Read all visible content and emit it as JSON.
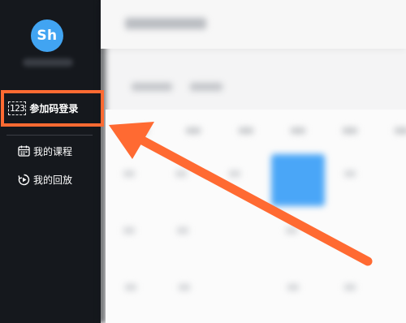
{
  "sidebar": {
    "avatar_text": "Sh",
    "join_item": {
      "icon_text": "123",
      "label": "参加码登录"
    },
    "nav_items": [
      {
        "icon": "calendar-icon",
        "label": "我的课程"
      },
      {
        "icon": "replay-icon",
        "label": "我的回放"
      }
    ]
  },
  "annotation": {
    "highlight_color": "#ff6a32",
    "arrow_color": "#ff6a32"
  },
  "colors": {
    "sidebar_bg": "#15181d",
    "avatar_bg": "#41a4f2",
    "today_cell": "#4aa6f7"
  }
}
